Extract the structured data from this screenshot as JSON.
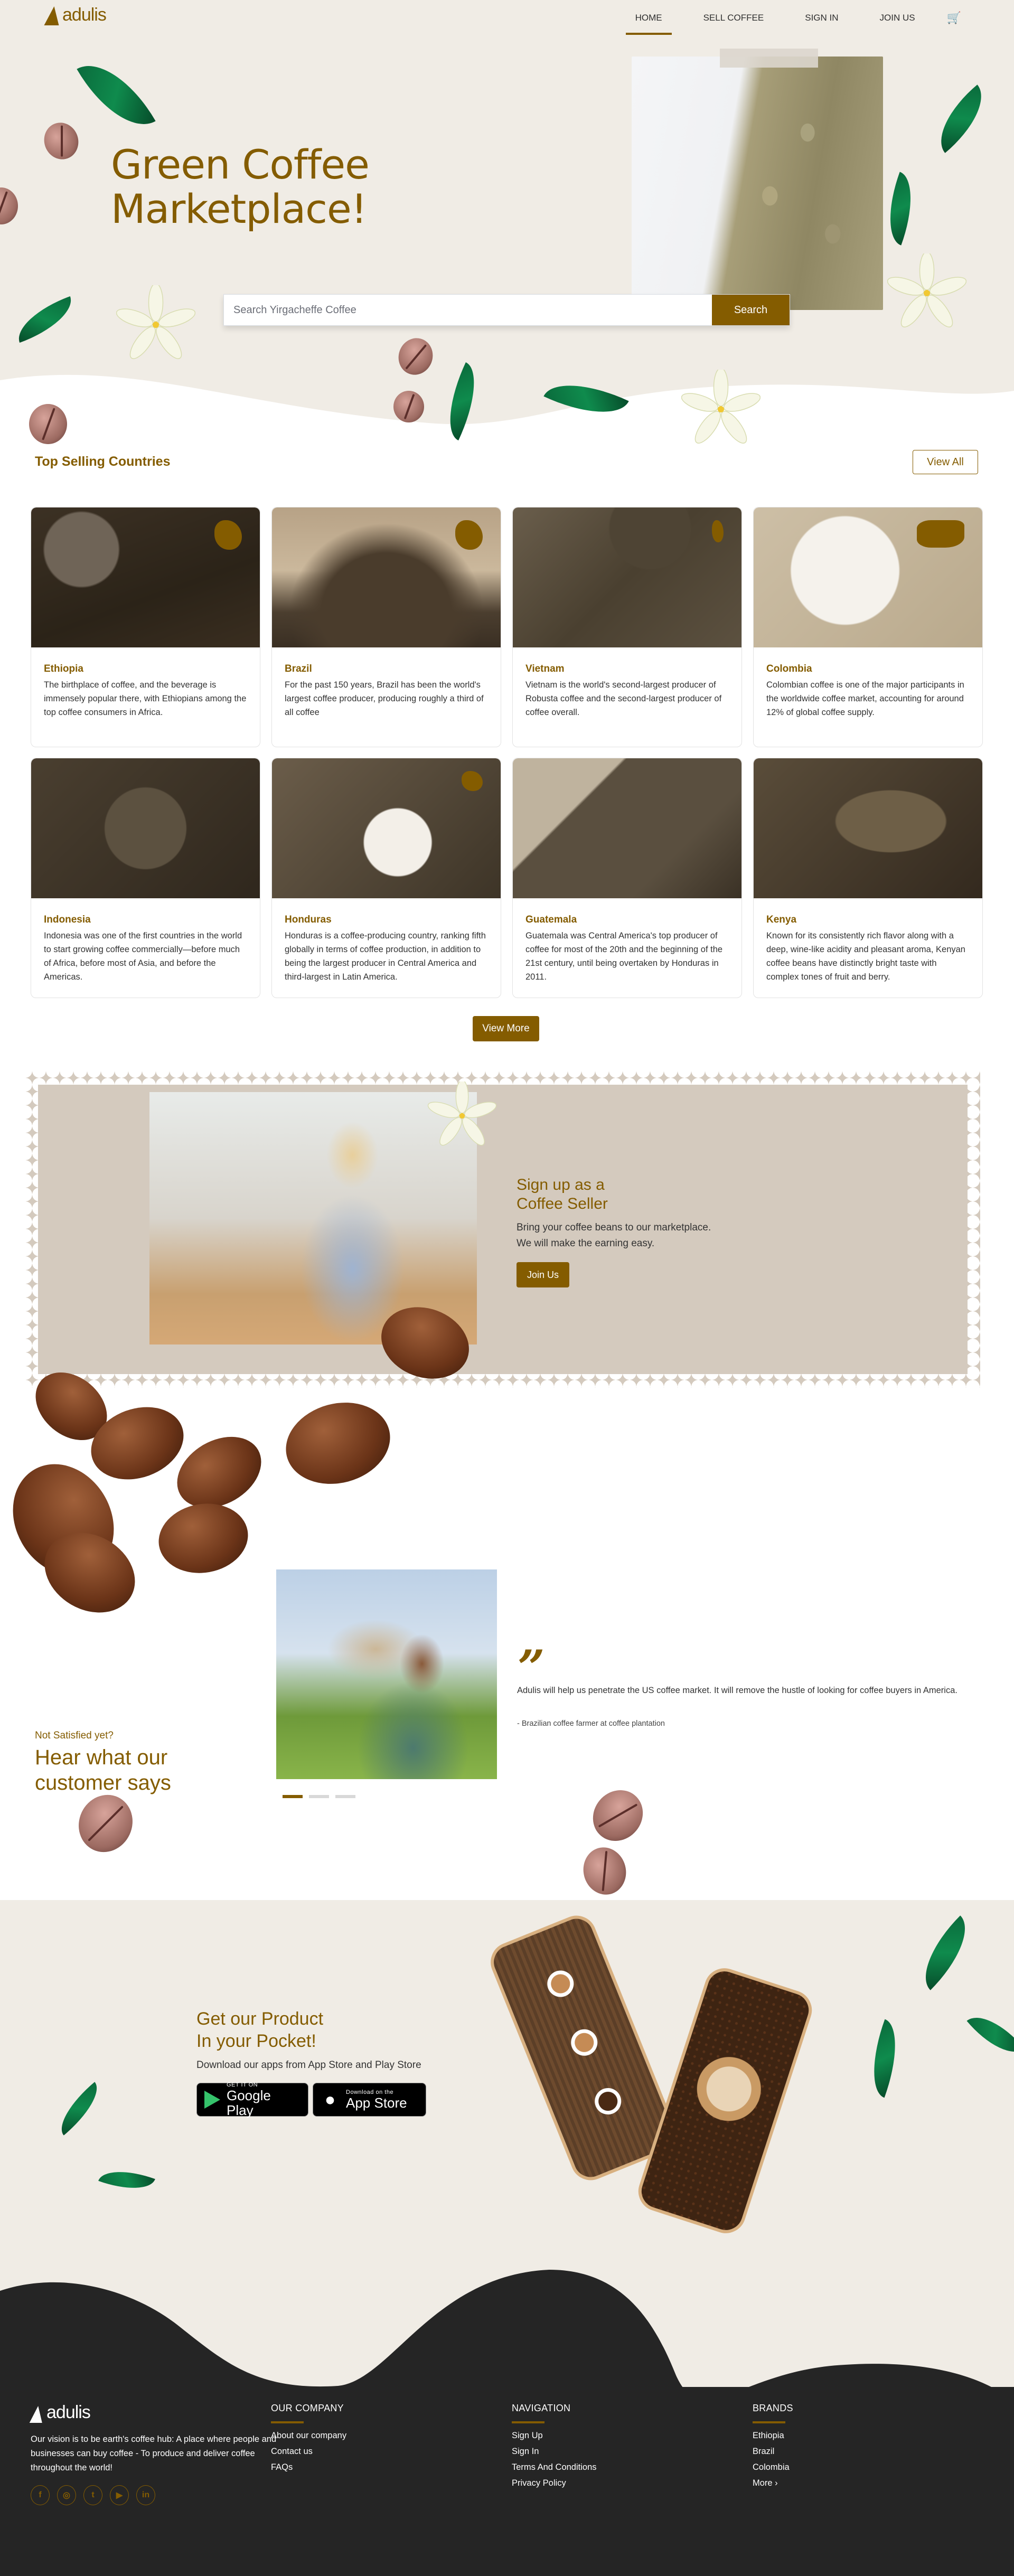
{
  "brand": {
    "name": "adulis",
    "accent_color": "#845c00",
    "bg_cream": "#f0ece5",
    "footer_bg": "#252525"
  },
  "nav": {
    "items": [
      {
        "label": "HOME",
        "active": true
      },
      {
        "label": "SELL COFFEE",
        "active": false
      },
      {
        "label": "SIGN IN",
        "active": false
      },
      {
        "label": "JOIN US",
        "active": false
      }
    ],
    "cart_icon": "cart-icon"
  },
  "hero": {
    "title_line1": "Green Coffee",
    "title_line2": "Marketplace!",
    "search": {
      "placeholder": "Search Yirgacheffe Coffee",
      "value": "",
      "button_label": "Search"
    }
  },
  "countries": {
    "title": "Top Selling Countries",
    "view_all_label": "View All",
    "view_more_label": "View More",
    "items": [
      {
        "name": "Ethiopia",
        "text": "The birthplace of coffee, and the beverage is immensely popular there, with Ethiopians among the top coffee consumers in Africa."
      },
      {
        "name": "Brazil",
        "text": "For the past 150 years, Brazil has been the world's largest coffee producer, producing roughly a third of all coffee"
      },
      {
        "name": "Vietnam",
        "text": "Vietnam is the world's second-largest producer of Robusta coffee and the second-largest producer of coffee overall."
      },
      {
        "name": "Colombia",
        "text": "Colombian coffee is one of the major participants in the worldwide coffee market, accounting for around 12% of global coffee supply."
      },
      {
        "name": "Indonesia",
        "text": "Indonesia was one of the first countries in the world to start growing coffee commercially—before much of Africa, before most of Asia, and before the Americas."
      },
      {
        "name": "Honduras",
        "text": "Honduras is a coffee-producing country, ranking fifth globally in terms of coffee production, in addition to being the largest producer in Central America and third-largest in Latin America."
      },
      {
        "name": "Guatemala",
        "text": "Guatemala was Central America's top producer of coffee for most of the 20th and the beginning of the 21st century, until being overtaken by Honduras in 2011."
      },
      {
        "name": "Kenya",
        "text": "Known for its consistently rich flavor along with a deep, wine-like acidity and pleasant aroma, Kenyan coffee beans have distinctly bright taste with complex tones of fruit and berry."
      }
    ]
  },
  "seller": {
    "title_line1": "Sign up as a",
    "title_line2": "Coffee Seller",
    "text_line1": "Bring your coffee beans to our marketplace.",
    "text_line2": "We will make the earning easy.",
    "button_label": "Join Us"
  },
  "testimonials": {
    "subtitle": "Not Satisfied yet?",
    "title_line1": "Hear what our",
    "title_line2": "customer says",
    "quote_mark": "”",
    "quote": "Adulis will help us penetrate the US coffee market. It will remove the hustle of looking for coffee buyers in America.",
    "author": "- Brazilian coffee farmer at coffee plantation",
    "slides": 3,
    "active_slide": 1
  },
  "app": {
    "title_line1": "Get our Product",
    "title_line2": "In your Pocket!",
    "text": "Download our apps from App Store and Play Store",
    "google_play": {
      "small": "GET IT ON",
      "big": "Google Play"
    },
    "app_store": {
      "small": "Download on the",
      "big": "App Store"
    }
  },
  "footer": {
    "vision": "Our vision is to be earth's coffee hub: A place where people and businesses can buy coffee - To produce and deliver coffee throughout the world!",
    "socials": [
      {
        "name": "facebook",
        "glyph": "f"
      },
      {
        "name": "instagram",
        "glyph": "◎"
      },
      {
        "name": "twitter",
        "glyph": "t"
      },
      {
        "name": "youtube",
        "glyph": "▶"
      },
      {
        "name": "linkedin",
        "glyph": "in"
      }
    ],
    "columns": [
      {
        "title": "OUR COMPANY",
        "links": [
          "About our company",
          "Contact us",
          "FAQs"
        ]
      },
      {
        "title": "NAVIGATION",
        "links": [
          "Sign Up",
          "Sign In",
          "Terms And Conditions",
          "Privacy Policy"
        ]
      },
      {
        "title": "BRANDS",
        "links": [
          "Ethiopia",
          "Brazil",
          "Colombia",
          "More ›"
        ]
      }
    ]
  }
}
